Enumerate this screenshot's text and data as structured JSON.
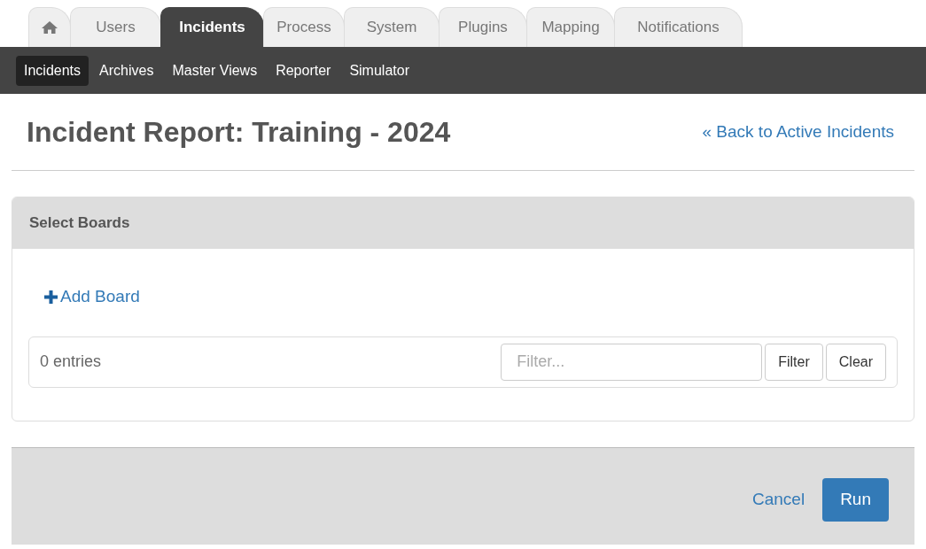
{
  "tabs": [
    {
      "kind": "home",
      "selected": false
    },
    {
      "kind": "text",
      "label": "Users",
      "selected": false
    },
    {
      "kind": "text",
      "label": "Incidents",
      "selected": true
    },
    {
      "kind": "text",
      "label": "Process",
      "selected": false
    },
    {
      "kind": "text",
      "label": "System",
      "selected": false
    },
    {
      "kind": "text",
      "label": "Plugins",
      "selected": false
    },
    {
      "kind": "text",
      "label": "Mapping",
      "selected": false
    },
    {
      "kind": "text",
      "label": "Notifications",
      "selected": false
    }
  ],
  "subnav": [
    {
      "label": "Incidents",
      "selected": true
    },
    {
      "label": "Archives",
      "selected": false
    },
    {
      "label": "Master Views",
      "selected": false
    },
    {
      "label": "Reporter",
      "selected": false
    },
    {
      "label": "Simulator",
      "selected": false
    }
  ],
  "page_title": "Incident Report: Training - 2024",
  "back_link": "« Back to Active Incidents",
  "panel": {
    "title": "Select Boards",
    "add_link": "Add Board",
    "entries": "0 entries",
    "filter": {
      "placeholder": "Filter..."
    },
    "filter_button": "Filter",
    "clear_button": "Clear"
  },
  "footer": {
    "cancel": "Cancel",
    "run": "Run"
  }
}
